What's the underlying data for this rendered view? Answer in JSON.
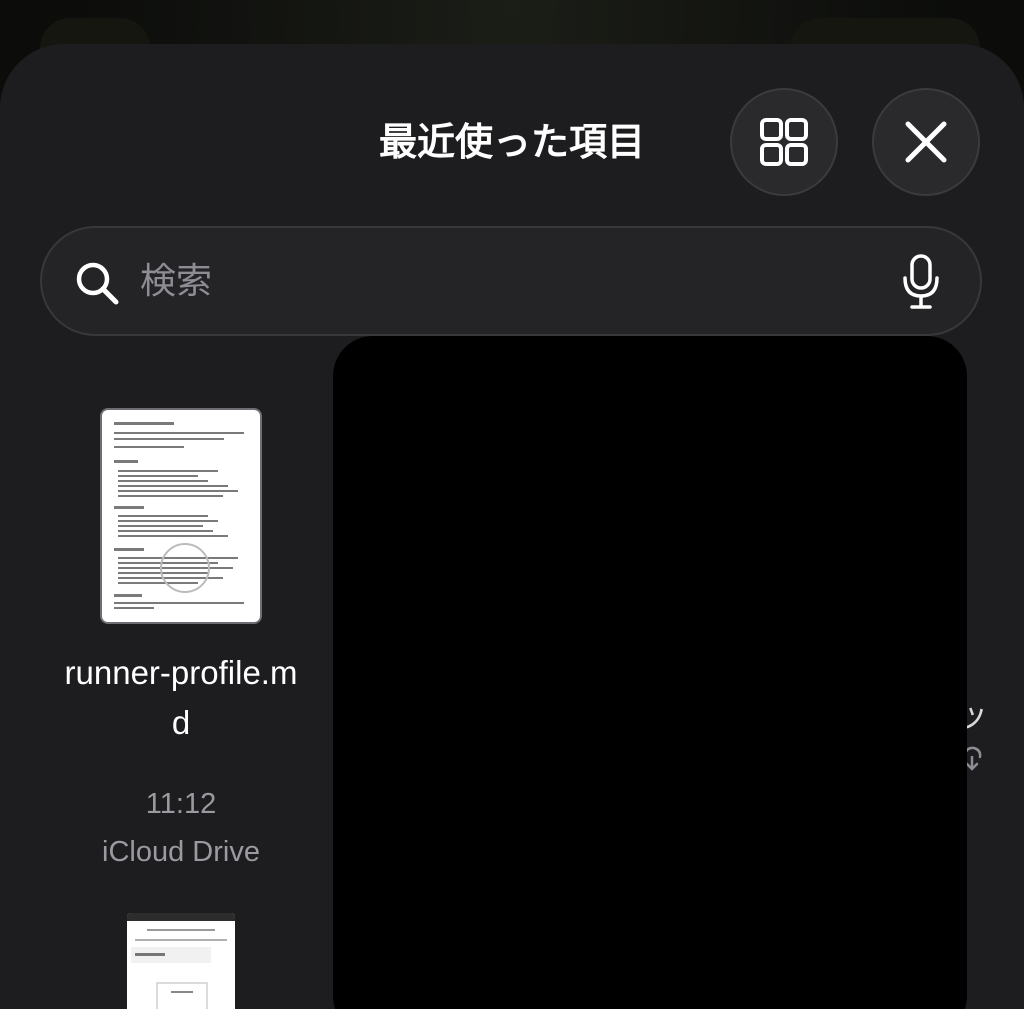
{
  "sheet": {
    "title": "最近使った項目",
    "grid_button_icon": "grid-view-icon",
    "close_button_icon": "close-icon"
  },
  "search": {
    "placeholder": "検索",
    "icon": "search-icon",
    "mic_icon": "microphone-icon"
  },
  "files": [
    {
      "name": "runner-profile.md",
      "time": "11:12",
      "location": "iCloud Drive"
    }
  ],
  "partial_tile": {
    "text": "ッ",
    "icon": "cloud-download-icon"
  },
  "colors": {
    "sheet_background": "#1d1d20",
    "button_background": "#2a2a2d",
    "secondary_text": "#9a9aa0",
    "primary_text": "#ffffff"
  }
}
